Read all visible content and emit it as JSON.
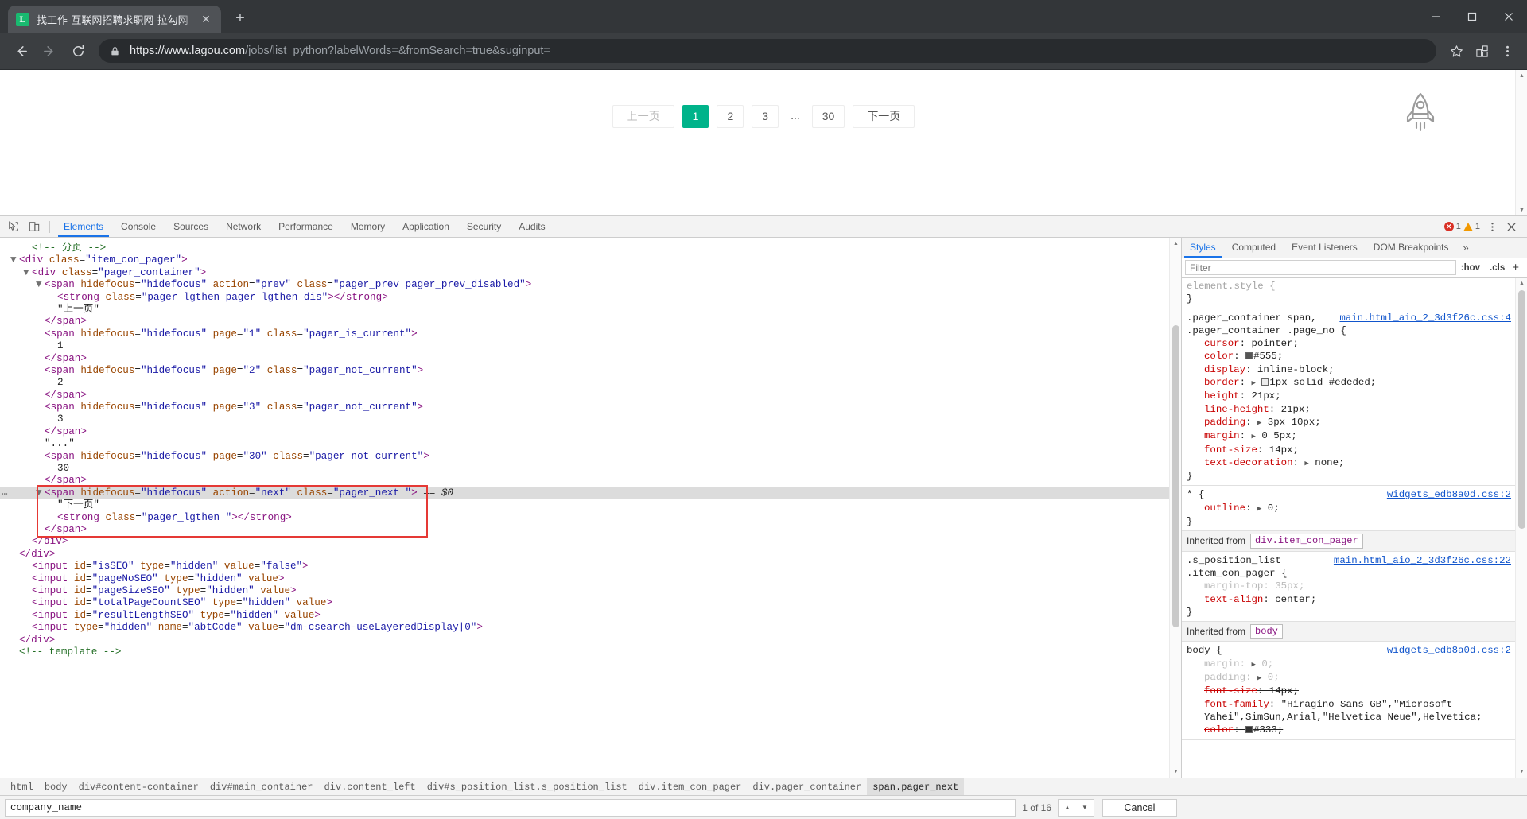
{
  "browser": {
    "tab": {
      "favicon_letter": "L",
      "title": "找工作-互联网招聘求职网-拉勾网",
      "close_icon": "✕"
    },
    "new_tab_label": "+",
    "window_controls": {
      "minimize": "minimize-icon",
      "maximize": "maximize-icon",
      "close": "close-icon"
    },
    "nav": {
      "back": "back-arrow-icon",
      "forward": "forward-arrow-icon",
      "reload": "reload-icon"
    },
    "omnibox": {
      "security_icon": "lock-icon",
      "url_scheme_host": "https://www.lagou.com",
      "url_path_query": "/jobs/list_python?labelWords=&fromSearch=true&suginput=",
      "full_url": "https://www.lagou.com/jobs/list_python?labelWords=&fromSearch=true&suginput="
    },
    "toolbar_icons": [
      "star-icon",
      "extensions-icon",
      "more-menu-icon"
    ]
  },
  "page": {
    "pager": {
      "prev_label": "上一页",
      "pages": [
        "1",
        "2",
        "3"
      ],
      "ellipsis": "...",
      "last_page": "30",
      "next_label": "下一页",
      "current_page": "1",
      "current_bg": "#00b38a"
    },
    "rocket_icon": "rocket-back-to-top-icon"
  },
  "devtools": {
    "toolbar": {
      "inspect_icon": "inspect-element-icon",
      "device_icon": "device-toolbar-icon",
      "tabs": [
        "Elements",
        "Console",
        "Sources",
        "Network",
        "Performance",
        "Memory",
        "Application",
        "Security",
        "Audits"
      ],
      "active_tab": "Elements",
      "error_count": "1",
      "warning_count": "1",
      "more_icon": "kebab-menu-icon",
      "close_icon": "close-devtools-icon"
    },
    "dom": {
      "lines": [
        {
          "indent": 2,
          "tri": "",
          "html": "<span class=\"comment\">&lt;!-- 分页 --&gt;</span>"
        },
        {
          "indent": 1,
          "tri": "▼",
          "html": "<span class=\"punct\">&lt;</span><span class=\"tagname\">div</span> <span class=\"attrname\">class</span>=<span class=\"attrval\">\"item_con_pager\"</span><span class=\"punct\">&gt;</span>"
        },
        {
          "indent": 2,
          "tri": "▼",
          "html": "<span class=\"punct\">&lt;</span><span class=\"tagname\">div</span> <span class=\"attrname\">class</span>=<span class=\"attrval\">\"pager_container\"</span><span class=\"punct\">&gt;</span>"
        },
        {
          "indent": 3,
          "tri": "▼",
          "html": "<span class=\"punct\">&lt;</span><span class=\"tagname\">span</span> <span class=\"attrname\">hidefocus</span>=<span class=\"attrval\">\"hidefocus\"</span> <span class=\"attrname\">action</span>=<span class=\"attrval\">\"prev\"</span> <span class=\"attrname\">class</span>=<span class=\"attrval\">\"pager_prev pager_prev_disabled\"</span><span class=\"punct\">&gt;</span>"
        },
        {
          "indent": 4,
          "tri": "",
          "html": "<span class=\"punct\">&lt;</span><span class=\"tagname\">strong</span> <span class=\"attrname\">class</span>=<span class=\"attrval\">\"pager_lgthen pager_lgthen_dis\"</span><span class=\"punct\">&gt;&lt;/</span><span class=\"tagname\">strong</span><span class=\"punct\">&gt;</span>"
        },
        {
          "indent": 4,
          "tri": "",
          "html": "<span class=\"txt\">\"上一页\"</span>"
        },
        {
          "indent": 3,
          "tri": "",
          "html": "<span class=\"punct\">&lt;/</span><span class=\"tagname\">span</span><span class=\"punct\">&gt;</span>"
        },
        {
          "indent": 3,
          "tri": "",
          "html": "<span class=\"punct\">&lt;</span><span class=\"tagname\">span</span> <span class=\"attrname\">hidefocus</span>=<span class=\"attrval\">\"hidefocus\"</span> <span class=\"attrname\">page</span>=<span class=\"attrval\">\"1\"</span> <span class=\"attrname\">class</span>=<span class=\"attrval\">\"pager_is_current\"</span><span class=\"punct\">&gt;</span>"
        },
        {
          "indent": 4,
          "tri": "",
          "html": "<span class=\"txt\">1</span>"
        },
        {
          "indent": 3,
          "tri": "",
          "html": "<span class=\"punct\">&lt;/</span><span class=\"tagname\">span</span><span class=\"punct\">&gt;</span>"
        },
        {
          "indent": 3,
          "tri": "",
          "html": "<span class=\"punct\">&lt;</span><span class=\"tagname\">span</span> <span class=\"attrname\">hidefocus</span>=<span class=\"attrval\">\"hidefocus\"</span> <span class=\"attrname\">page</span>=<span class=\"attrval\">\"2\"</span> <span class=\"attrname\">class</span>=<span class=\"attrval\">\"pager_not_current\"</span><span class=\"punct\">&gt;</span>"
        },
        {
          "indent": 4,
          "tri": "",
          "html": "<span class=\"txt\">2</span>"
        },
        {
          "indent": 3,
          "tri": "",
          "html": "<span class=\"punct\">&lt;/</span><span class=\"tagname\">span</span><span class=\"punct\">&gt;</span>"
        },
        {
          "indent": 3,
          "tri": "",
          "html": "<span class=\"punct\">&lt;</span><span class=\"tagname\">span</span> <span class=\"attrname\">hidefocus</span>=<span class=\"attrval\">\"hidefocus\"</span> <span class=\"attrname\">page</span>=<span class=\"attrval\">\"3\"</span> <span class=\"attrname\">class</span>=<span class=\"attrval\">\"pager_not_current\"</span><span class=\"punct\">&gt;</span>"
        },
        {
          "indent": 4,
          "tri": "",
          "html": "<span class=\"txt\">3</span>"
        },
        {
          "indent": 3,
          "tri": "",
          "html": "<span class=\"punct\">&lt;/</span><span class=\"tagname\">span</span><span class=\"punct\">&gt;</span>"
        },
        {
          "indent": 3,
          "tri": "",
          "html": "<span class=\"txt\">\"...\"</span>"
        },
        {
          "indent": 3,
          "tri": "",
          "html": "<span class=\"punct\">&lt;</span><span class=\"tagname\">span</span> <span class=\"attrname\">hidefocus</span>=<span class=\"attrval\">\"hidefocus\"</span> <span class=\"attrname\">page</span>=<span class=\"attrval\">\"30\"</span> <span class=\"attrname\">class</span>=<span class=\"attrval\">\"pager_not_current\"</span><span class=\"punct\">&gt;</span>"
        },
        {
          "indent": 4,
          "tri": "",
          "html": "<span class=\"txt\">30</span>"
        },
        {
          "indent": 3,
          "tri": "",
          "html": "<span class=\"punct\">&lt;/</span><span class=\"tagname\">span</span><span class=\"punct\">&gt;</span>"
        },
        {
          "indent": 3,
          "tri": "▼",
          "selected": true,
          "html": "<span class=\"punct\">&lt;</span><span class=\"tagname\">span</span> <span class=\"attrname\">hidefocus</span>=<span class=\"attrval\">\"hidefocus\"</span> <span class=\"attrname\">action</span>=<span class=\"attrval\">\"next\"</span> <span class=\"attrname\">class</span>=<span class=\"attrval\">\"pager_next \"</span><span class=\"punct\">&gt;</span> <span class=\"dollar\">== $0</span>"
        },
        {
          "indent": 4,
          "tri": "",
          "html": "<span class=\"txt\">\"下一页\"</span>"
        },
        {
          "indent": 4,
          "tri": "",
          "html": "<span class=\"punct\">&lt;</span><span class=\"tagname\">strong</span> <span class=\"attrname\">class</span>=<span class=\"attrval\">\"pager_lgthen \"</span><span class=\"punct\">&gt;&lt;/</span><span class=\"tagname\">strong</span><span class=\"punct\">&gt;</span>"
        },
        {
          "indent": 3,
          "tri": "",
          "html": "<span class=\"punct\">&lt;/</span><span class=\"tagname\">span</span><span class=\"punct\">&gt;</span>"
        },
        {
          "indent": 2,
          "tri": "",
          "html": "<span class=\"punct\">&lt;/</span><span class=\"tagname\">div</span><span class=\"punct\">&gt;</span>"
        },
        {
          "indent": 1,
          "tri": "",
          "html": "<span class=\"punct\">&lt;/</span><span class=\"tagname\">div</span><span class=\"punct\">&gt;</span>"
        },
        {
          "indent": 2,
          "tri": "",
          "html": "<span class=\"punct\">&lt;</span><span class=\"tagname\">input</span> <span class=\"attrname\">id</span>=<span class=\"attrval\">\"isSEO\"</span> <span class=\"attrname\">type</span>=<span class=\"attrval\">\"hidden\"</span> <span class=\"attrname\">value</span>=<span class=\"attrval\">\"false\"</span><span class=\"punct\">&gt;</span>"
        },
        {
          "indent": 2,
          "tri": "",
          "html": "<span class=\"punct\">&lt;</span><span class=\"tagname\">input</span> <span class=\"attrname\">id</span>=<span class=\"attrval\">\"pageNoSEO\"</span> <span class=\"attrname\">type</span>=<span class=\"attrval\">\"hidden\"</span> <span class=\"attrname\">value</span><span class=\"punct\">&gt;</span>"
        },
        {
          "indent": 2,
          "tri": "",
          "html": "<span class=\"punct\">&lt;</span><span class=\"tagname\">input</span> <span class=\"attrname\">id</span>=<span class=\"attrval\">\"pageSizeSEO\"</span> <span class=\"attrname\">type</span>=<span class=\"attrval\">\"hidden\"</span> <span class=\"attrname\">value</span><span class=\"punct\">&gt;</span>"
        },
        {
          "indent": 2,
          "tri": "",
          "html": "<span class=\"punct\">&lt;</span><span class=\"tagname\">input</span> <span class=\"attrname\">id</span>=<span class=\"attrval\">\"totalPageCountSEO\"</span> <span class=\"attrname\">type</span>=<span class=\"attrval\">\"hidden\"</span> <span class=\"attrname\">value</span><span class=\"punct\">&gt;</span>"
        },
        {
          "indent": 2,
          "tri": "",
          "html": "<span class=\"punct\">&lt;</span><span class=\"tagname\">input</span> <span class=\"attrname\">id</span>=<span class=\"attrval\">\"resultLengthSEO\"</span> <span class=\"attrname\">type</span>=<span class=\"attrval\">\"hidden\"</span> <span class=\"attrname\">value</span><span class=\"punct\">&gt;</span>"
        },
        {
          "indent": 2,
          "tri": "",
          "html": "<span class=\"punct\">&lt;</span><span class=\"tagname\">input</span> <span class=\"attrname\">type</span>=<span class=\"attrval\">\"hidden\"</span> <span class=\"attrname\">name</span>=<span class=\"attrval\">\"abtCode\"</span> <span class=\"attrname\">value</span>=<span class=\"attrval\">\"dm-csearch-useLayeredDisplay|0\"</span><span class=\"punct\">&gt;</span>"
        },
        {
          "indent": 1,
          "tri": "",
          "html": "<span class=\"punct\">&lt;/</span><span class=\"tagname\">div</span><span class=\"punct\">&gt;</span>"
        },
        {
          "indent": 1,
          "tri": "",
          "html": "<span class=\"comment\">&lt;!-- template --&gt;</span>"
        }
      ]
    },
    "styles": {
      "tabs": [
        "Styles",
        "Computed",
        "Event Listeners",
        "DOM Breakpoints"
      ],
      "active_tab": "Styles",
      "more_tabs_icon": "chevron-double-right-icon",
      "filter_placeholder": "Filter",
      "hov_label": ":hov",
      "cls_label": ".cls",
      "add_rule_label": "+",
      "rules": [
        {
          "selector": "element.style {",
          "source": "",
          "declarations": [],
          "close": "}"
        },
        {
          "selector": ".pager_container span,\n.pager_container .page_no {",
          "source": "main.html_aio_2_3d3f26c.css:4",
          "declarations": [
            {
              "prop": "cursor",
              "value": "pointer"
            },
            {
              "prop": "color",
              "value": "#555",
              "swatch": "#555555"
            },
            {
              "prop": "display",
              "value": "inline-block"
            },
            {
              "prop": "border",
              "value": "1px solid #ededed",
              "swatch": "#ededed",
              "expandable": true
            },
            {
              "prop": "height",
              "value": "21px"
            },
            {
              "prop": "line-height",
              "value": "21px"
            },
            {
              "prop": "padding",
              "value": "3px 10px",
              "expandable": true
            },
            {
              "prop": "margin",
              "value": "0 5px",
              "expandable": true
            },
            {
              "prop": "font-size",
              "value": "14px"
            },
            {
              "prop": "text-decoration",
              "value": "none",
              "expandable": true
            }
          ],
          "close": "}"
        },
        {
          "selector": "* {",
          "source": "widgets_edb8a0d.css:2",
          "declarations": [
            {
              "prop": "outline",
              "value": "0",
              "expandable": true
            }
          ],
          "close": "}"
        }
      ],
      "inherited_1": {
        "label": "Inherited from",
        "chip": "div.item_con_pager"
      },
      "rule_inherited_1": {
        "selector": ".s_position_list\n.item_con_pager {",
        "source": "main.html_aio_2_3d3f26c.css:22",
        "declarations": [
          {
            "prop": "margin-top",
            "value": "35px",
            "inactive": true
          },
          {
            "prop": "text-align",
            "value": "center"
          }
        ],
        "close": "}"
      },
      "inherited_2": {
        "label": "Inherited from",
        "chip": "body"
      },
      "rule_inherited_2": {
        "selector": "body {",
        "source": "widgets_edb8a0d.css:2",
        "declarations": [
          {
            "prop": "margin",
            "value": "0",
            "inactive": true,
            "expandable": true
          },
          {
            "prop": "padding",
            "value": "0",
            "inactive": true,
            "expandable": true
          },
          {
            "prop": "font-size",
            "value": "14px",
            "strike": true
          },
          {
            "prop": "font-family",
            "value": "\"Hiragino Sans GB\",\"Microsoft Yahei\",SimSun,Arial,\"Helvetica Neue\",Helvetica"
          },
          {
            "prop": "color",
            "value": "#333",
            "strike": true,
            "swatch": "#333333"
          }
        ]
      }
    },
    "breadcrumb": [
      "html",
      "body",
      "div#content-container",
      "div#main_container",
      "div.content_left",
      "div#s_position_list.s_position_list",
      "div.item_con_pager",
      "div.pager_container",
      "span.pager_next"
    ],
    "breadcrumb_active": "span.pager_next",
    "find": {
      "query": "company_name",
      "match_count": "1 of 16",
      "prev_icon": "chevron-up-icon",
      "next_icon": "chevron-down-icon",
      "cancel_label": "Cancel"
    }
  }
}
